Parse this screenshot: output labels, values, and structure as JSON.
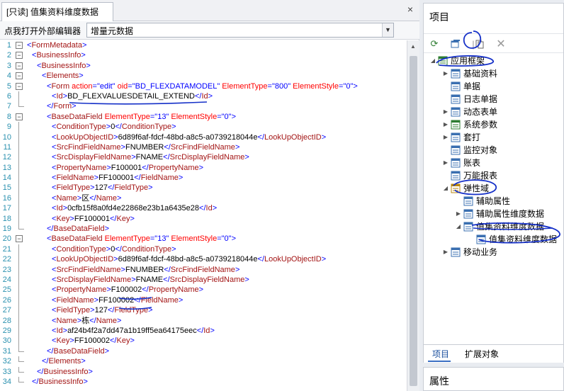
{
  "left": {
    "tab_title": "[只读] 值集资料维度数据",
    "tab_close": "×",
    "toolbar_label": "点我打开外部编辑器",
    "selected_option": "增量元数据"
  },
  "xml_lines": [
    {
      "n": "1",
      "indent": 0,
      "fold": "-",
      "parts": [
        [
          "br",
          "<"
        ],
        [
          "tag",
          "FormMetadata"
        ],
        [
          "br",
          ">"
        ]
      ]
    },
    {
      "n": "2",
      "indent": 1,
      "fold": "-",
      "parts": [
        [
          "br",
          "<"
        ],
        [
          "tag",
          "BusinessInfo"
        ],
        [
          "br",
          ">"
        ]
      ]
    },
    {
      "n": "3",
      "indent": 2,
      "fold": "-",
      "parts": [
        [
          "br",
          "<"
        ],
        [
          "tag",
          "BusinessInfo"
        ],
        [
          "br",
          ">"
        ]
      ]
    },
    {
      "n": "4",
      "indent": 3,
      "fold": "-",
      "parts": [
        [
          "br",
          "<"
        ],
        [
          "tag",
          "Elements"
        ],
        [
          "br",
          ">"
        ]
      ]
    },
    {
      "n": "5",
      "indent": 4,
      "fold": "-",
      "parts": [
        [
          "br",
          "<"
        ],
        [
          "tag",
          "Form "
        ],
        [
          "attr",
          "action"
        ],
        [
          "br",
          "="
        ],
        [
          "val",
          "\"edit\""
        ],
        [
          "attr",
          " oid"
        ],
        [
          "br",
          "="
        ],
        [
          "val",
          "\"BD_FLEXDATAMODEL\""
        ],
        [
          "attr",
          " ElementType"
        ],
        [
          "br",
          "="
        ],
        [
          "val",
          "\"800\""
        ],
        [
          "attr",
          " ElementStyle"
        ],
        [
          "br",
          "="
        ],
        [
          "val",
          "\"0\""
        ],
        [
          "br",
          ">"
        ]
      ]
    },
    {
      "n": "6",
      "indent": 5,
      "fold": "",
      "parts": [
        [
          "br",
          "<"
        ],
        [
          "tag",
          "Id"
        ],
        [
          "br",
          ">"
        ],
        [
          "txt",
          "BD_FLEXVALUESDETAIL_EXTEND"
        ],
        [
          "br",
          "</"
        ],
        [
          "tag",
          "Id"
        ],
        [
          "br",
          ">"
        ]
      ]
    },
    {
      "n": "7",
      "indent": 4,
      "fold": "end",
      "parts": [
        [
          "br",
          "</"
        ],
        [
          "tag",
          "Form"
        ],
        [
          "br",
          ">"
        ]
      ]
    },
    {
      "n": "8",
      "indent": 4,
      "fold": "-",
      "parts": [
        [
          "br",
          "<"
        ],
        [
          "tag",
          "BaseDataField "
        ],
        [
          "attr",
          "ElementType"
        ],
        [
          "br",
          "="
        ],
        [
          "val",
          "\"13\""
        ],
        [
          "attr",
          " ElementStyle"
        ],
        [
          "br",
          "="
        ],
        [
          "val",
          "\"0\""
        ],
        [
          "br",
          ">"
        ]
      ]
    },
    {
      "n": "9",
      "indent": 5,
      "fold": "",
      "parts": [
        [
          "br",
          "<"
        ],
        [
          "tag",
          "ConditionType"
        ],
        [
          "br",
          ">"
        ],
        [
          "txt",
          "0"
        ],
        [
          "br",
          "</"
        ],
        [
          "tag",
          "ConditionType"
        ],
        [
          "br",
          ">"
        ]
      ]
    },
    {
      "n": "10",
      "indent": 5,
      "fold": "",
      "parts": [
        [
          "br",
          "<"
        ],
        [
          "tag",
          "LookUpObjectID"
        ],
        [
          "br",
          ">"
        ],
        [
          "txt",
          "6d89f6af-fdcf-48bd-a8c5-a0739218044e"
        ],
        [
          "br",
          "</"
        ],
        [
          "tag",
          "LookUpObjectID"
        ],
        [
          "br",
          ">"
        ]
      ]
    },
    {
      "n": "11",
      "indent": 5,
      "fold": "",
      "parts": [
        [
          "br",
          "<"
        ],
        [
          "tag",
          "SrcFindFieldName"
        ],
        [
          "br",
          ">"
        ],
        [
          "txt",
          "FNUMBER"
        ],
        [
          "br",
          "</"
        ],
        [
          "tag",
          "SrcFindFieldName"
        ],
        [
          "br",
          ">"
        ]
      ]
    },
    {
      "n": "12",
      "indent": 5,
      "fold": "",
      "parts": [
        [
          "br",
          "<"
        ],
        [
          "tag",
          "SrcDisplayFieldName"
        ],
        [
          "br",
          ">"
        ],
        [
          "txt",
          "FNAME"
        ],
        [
          "br",
          "</"
        ],
        [
          "tag",
          "SrcDisplayFieldName"
        ],
        [
          "br",
          ">"
        ]
      ]
    },
    {
      "n": "13",
      "indent": 5,
      "fold": "",
      "parts": [
        [
          "br",
          "<"
        ],
        [
          "tag",
          "PropertyName"
        ],
        [
          "br",
          ">"
        ],
        [
          "txt",
          "F100001"
        ],
        [
          "br",
          "</"
        ],
        [
          "tag",
          "PropertyName"
        ],
        [
          "br",
          ">"
        ]
      ]
    },
    {
      "n": "14",
      "indent": 5,
      "fold": "",
      "parts": [
        [
          "br",
          "<"
        ],
        [
          "tag",
          "FieldName"
        ],
        [
          "br",
          ">"
        ],
        [
          "txt",
          "FF100001"
        ],
        [
          "br",
          "</"
        ],
        [
          "tag",
          "FieldName"
        ],
        [
          "br",
          ">"
        ]
      ]
    },
    {
      "n": "15",
      "indent": 5,
      "fold": "",
      "parts": [
        [
          "br",
          "<"
        ],
        [
          "tag",
          "FieldType"
        ],
        [
          "br",
          ">"
        ],
        [
          "txt",
          "127"
        ],
        [
          "br",
          "</"
        ],
        [
          "tag",
          "FieldType"
        ],
        [
          "br",
          ">"
        ]
      ]
    },
    {
      "n": "16",
      "indent": 5,
      "fold": "",
      "parts": [
        [
          "br",
          "<"
        ],
        [
          "tag",
          "Name"
        ],
        [
          "br",
          ">"
        ],
        [
          "txt",
          "区"
        ],
        [
          "br",
          "</"
        ],
        [
          "tag",
          "Name"
        ],
        [
          "br",
          ">"
        ]
      ]
    },
    {
      "n": "17",
      "indent": 5,
      "fold": "",
      "parts": [
        [
          "br",
          "<"
        ],
        [
          "tag",
          "Id"
        ],
        [
          "br",
          ">"
        ],
        [
          "txt",
          "0cfb15f8a0fd4e22868e23b1a6435e28"
        ],
        [
          "br",
          "</"
        ],
        [
          "tag",
          "Id"
        ],
        [
          "br",
          ">"
        ]
      ]
    },
    {
      "n": "18",
      "indent": 5,
      "fold": "",
      "parts": [
        [
          "br",
          "<"
        ],
        [
          "tag",
          "Key"
        ],
        [
          "br",
          ">"
        ],
        [
          "txt",
          "FF100001"
        ],
        [
          "br",
          "</"
        ],
        [
          "tag",
          "Key"
        ],
        [
          "br",
          ">"
        ]
      ]
    },
    {
      "n": "19",
      "indent": 4,
      "fold": "end",
      "parts": [
        [
          "br",
          "</"
        ],
        [
          "tag",
          "BaseDataField"
        ],
        [
          "br",
          ">"
        ]
      ]
    },
    {
      "n": "20",
      "indent": 4,
      "fold": "-",
      "parts": [
        [
          "br",
          "<"
        ],
        [
          "tag",
          "BaseDataField "
        ],
        [
          "attr",
          "ElementType"
        ],
        [
          "br",
          "="
        ],
        [
          "val",
          "\"13\""
        ],
        [
          "attr",
          " ElementStyle"
        ],
        [
          "br",
          "="
        ],
        [
          "val",
          "\"0\""
        ],
        [
          "br",
          ">"
        ]
      ]
    },
    {
      "n": "21",
      "indent": 5,
      "fold": "",
      "parts": [
        [
          "br",
          "<"
        ],
        [
          "tag",
          "ConditionType"
        ],
        [
          "br",
          ">"
        ],
        [
          "txt",
          "0"
        ],
        [
          "br",
          "</"
        ],
        [
          "tag",
          "ConditionType"
        ],
        [
          "br",
          ">"
        ]
      ]
    },
    {
      "n": "22",
      "indent": 5,
      "fold": "",
      "parts": [
        [
          "br",
          "<"
        ],
        [
          "tag",
          "LookUpObjectID"
        ],
        [
          "br",
          ">"
        ],
        [
          "txt",
          "6d89f6af-fdcf-48bd-a8c5-a0739218044e"
        ],
        [
          "br",
          "</"
        ],
        [
          "tag",
          "LookUpObjectID"
        ],
        [
          "br",
          ">"
        ]
      ]
    },
    {
      "n": "23",
      "indent": 5,
      "fold": "",
      "parts": [
        [
          "br",
          "<"
        ],
        [
          "tag",
          "SrcFindFieldName"
        ],
        [
          "br",
          ">"
        ],
        [
          "txt",
          "FNUMBER"
        ],
        [
          "br",
          "</"
        ],
        [
          "tag",
          "SrcFindFieldName"
        ],
        [
          "br",
          ">"
        ]
      ]
    },
    {
      "n": "24",
      "indent": 5,
      "fold": "",
      "parts": [
        [
          "br",
          "<"
        ],
        [
          "tag",
          "SrcDisplayFieldName"
        ],
        [
          "br",
          ">"
        ],
        [
          "txt",
          "FNAME"
        ],
        [
          "br",
          "</"
        ],
        [
          "tag",
          "SrcDisplayFieldName"
        ],
        [
          "br",
          ">"
        ]
      ]
    },
    {
      "n": "25",
      "indent": 5,
      "fold": "",
      "parts": [
        [
          "br",
          "<"
        ],
        [
          "tag",
          "PropertyName"
        ],
        [
          "br",
          ">"
        ],
        [
          "txt",
          "F100002"
        ],
        [
          "br",
          "</"
        ],
        [
          "tag",
          "PropertyName"
        ],
        [
          "br",
          ">"
        ]
      ]
    },
    {
      "n": "26",
      "indent": 5,
      "fold": "",
      "parts": [
        [
          "br",
          "<"
        ],
        [
          "tag",
          "FieldName"
        ],
        [
          "br",
          ">"
        ],
        [
          "txt",
          "FF100002"
        ],
        [
          "br",
          "</"
        ],
        [
          "tag",
          "FieldName"
        ],
        [
          "br",
          ">"
        ]
      ]
    },
    {
      "n": "27",
      "indent": 5,
      "fold": "",
      "parts": [
        [
          "br",
          "<"
        ],
        [
          "tag",
          "FieldType"
        ],
        [
          "br",
          ">"
        ],
        [
          "txt",
          "127"
        ],
        [
          "br",
          "</"
        ],
        [
          "tag",
          "FieldType"
        ],
        [
          "br",
          ">"
        ]
      ]
    },
    {
      "n": "28",
      "indent": 5,
      "fold": "",
      "parts": [
        [
          "br",
          "<"
        ],
        [
          "tag",
          "Name"
        ],
        [
          "br",
          ">"
        ],
        [
          "txt",
          "栋"
        ],
        [
          "br",
          "</"
        ],
        [
          "tag",
          "Name"
        ],
        [
          "br",
          ">"
        ]
      ]
    },
    {
      "n": "29",
      "indent": 5,
      "fold": "",
      "parts": [
        [
          "br",
          "<"
        ],
        [
          "tag",
          "Id"
        ],
        [
          "br",
          ">"
        ],
        [
          "txt",
          "af24b4f2a7dd47a1b19ff5ea64175eec"
        ],
        [
          "br",
          "</"
        ],
        [
          "tag",
          "Id"
        ],
        [
          "br",
          ">"
        ]
      ]
    },
    {
      "n": "30",
      "indent": 5,
      "fold": "",
      "parts": [
        [
          "br",
          "<"
        ],
        [
          "tag",
          "Key"
        ],
        [
          "br",
          ">"
        ],
        [
          "txt",
          "FF100002"
        ],
        [
          "br",
          "</"
        ],
        [
          "tag",
          "Key"
        ],
        [
          "br",
          ">"
        ]
      ]
    },
    {
      "n": "31",
      "indent": 4,
      "fold": "end",
      "parts": [
        [
          "br",
          "</"
        ],
        [
          "tag",
          "BaseDataField"
        ],
        [
          "br",
          ">"
        ]
      ]
    },
    {
      "n": "32",
      "indent": 3,
      "fold": "end",
      "parts": [
        [
          "br",
          "</"
        ],
        [
          "tag",
          "Elements"
        ],
        [
          "br",
          ">"
        ]
      ]
    },
    {
      "n": "33",
      "indent": 2,
      "fold": "end",
      "parts": [
        [
          "br",
          "</"
        ],
        [
          "tag",
          "BusinessInfo"
        ],
        [
          "br",
          ">"
        ]
      ]
    },
    {
      "n": "34",
      "indent": 1,
      "fold": "end",
      "parts": [
        [
          "br",
          "</"
        ],
        [
          "tag",
          "BusinessInfo"
        ],
        [
          "br",
          ">"
        ]
      ]
    }
  ],
  "right": {
    "panel_title": "项目",
    "tree": [
      {
        "label": "应用框架",
        "level": 0,
        "expander": "◢",
        "icon": "app-framework-icon",
        "color": "#2e7d32"
      },
      {
        "label": "基础资料",
        "level": 1,
        "expander": "▶",
        "icon": "basic-data-icon",
        "color": "#3a6fb0"
      },
      {
        "label": "单据",
        "level": 1,
        "expander": "",
        "icon": "document-icon",
        "color": "#3a6fb0"
      },
      {
        "label": "日志单据",
        "level": 1,
        "expander": "",
        "icon": "log-document-icon",
        "color": "#3a6fb0"
      },
      {
        "label": "动态表单",
        "level": 1,
        "expander": "▶",
        "icon": "dynamic-form-icon",
        "color": "#3a6fb0"
      },
      {
        "label": "系统参数",
        "level": 1,
        "expander": "▶",
        "icon": "system-params-icon",
        "color": "#2e7d32"
      },
      {
        "label": "套打",
        "level": 1,
        "expander": "▶",
        "icon": "print-template-icon",
        "color": "#3a6fb0"
      },
      {
        "label": "监控对象",
        "level": 1,
        "expander": "",
        "icon": "monitor-object-icon",
        "color": "#3a6fb0"
      },
      {
        "label": "账表",
        "level": 1,
        "expander": "▶",
        "icon": "account-report-icon",
        "color": "#3a6fb0"
      },
      {
        "label": "万能报表",
        "level": 1,
        "expander": "",
        "icon": "universal-report-icon",
        "color": "#3a6fb0"
      },
      {
        "label": "弹性域",
        "level": 1,
        "expander": "◢",
        "icon": "flex-field-icon",
        "color": "#b8860b"
      },
      {
        "label": "辅助属性",
        "level": 2,
        "expander": "",
        "icon": "aux-property-icon",
        "color": "#3a6fb0"
      },
      {
        "label": "辅助属性维度数据",
        "level": 2,
        "expander": "▶",
        "icon": "aux-dimension-icon",
        "color": "#3a6fb0"
      },
      {
        "label": "值集资料维度数据",
        "level": 2,
        "expander": "◢",
        "icon": "valueset-dimension-icon",
        "color": "#3a6fb0"
      },
      {
        "label": "值集资料维度数据",
        "level": 3,
        "expander": "",
        "icon": "valueset-dimension-leaf-icon",
        "color": "#3a6fb0"
      },
      {
        "label": "移动业务",
        "level": 1,
        "expander": "▶",
        "icon": "mobile-business-icon",
        "color": "#3a6fb0"
      }
    ],
    "tabs": [
      "项目",
      "扩展对象"
    ],
    "properties_title": "属性"
  }
}
